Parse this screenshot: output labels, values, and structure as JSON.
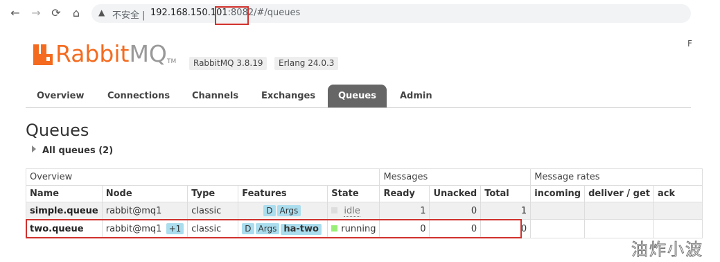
{
  "browser": {
    "back_icon": "←",
    "forward_icon": "→",
    "reload_icon": "⟳",
    "home_icon": "⌂",
    "warning_icon": "▲",
    "insecure_label": "不安全 |",
    "url_host": "192.168.150.101",
    "url_port": ":8082",
    "url_path": "/#/queues",
    "edge_char": "F"
  },
  "header": {
    "logo_rabbit": "Rabbit",
    "logo_mq": "MQ",
    "logo_tm": "TM",
    "version": "RabbitMQ 3.8.19",
    "erlang": "Erlang 24.0.3",
    "brand_color": "#f46b1f"
  },
  "tabs": [
    {
      "label": "Overview"
    },
    {
      "label": "Connections"
    },
    {
      "label": "Channels"
    },
    {
      "label": "Exchanges"
    },
    {
      "label": "Queues",
      "active": true
    },
    {
      "label": "Admin"
    }
  ],
  "page": {
    "title": "Queues",
    "all_queues": "All queues (2)"
  },
  "table": {
    "groups": {
      "overview": "Overview",
      "messages": "Messages",
      "rates": "Message rates"
    },
    "headers": {
      "name": "Name",
      "node": "Node",
      "type": "Type",
      "features": "Features",
      "state": "State",
      "ready": "Ready",
      "unacked": "Unacked",
      "total": "Total",
      "incoming": "incoming",
      "deliver": "deliver / get",
      "ack": "ack"
    },
    "rows": [
      {
        "name": "simple.queue",
        "node": "rabbit@mq1",
        "node_more": "",
        "type": "classic",
        "features": [
          "D",
          "Args"
        ],
        "feature_policy": "",
        "state": "idle",
        "ready": "1",
        "unacked": "0",
        "total": "1"
      },
      {
        "name": "two.queue",
        "node": "rabbit@mq1",
        "node_more": "+1",
        "type": "classic",
        "features": [
          "D",
          "Args"
        ],
        "feature_policy": "ha-two",
        "state": "running",
        "ready": "0",
        "unacked": "0",
        "total": "0"
      }
    ]
  },
  "watermark": "油炸小波",
  "colors": {
    "highlight": "#d0312d",
    "tag": "#aaddee",
    "running": "#99ee77",
    "idle": "#dddddd",
    "tab_active": "#666666"
  }
}
